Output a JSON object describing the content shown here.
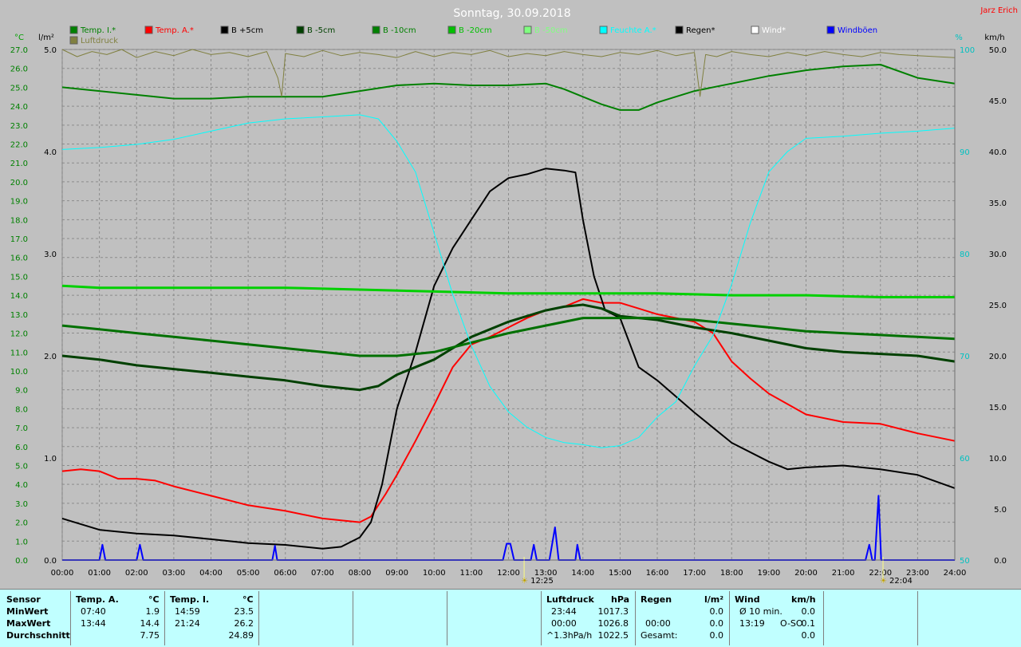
{
  "title": "Sonntag, 30.09.2018",
  "author": "Jarz Erich",
  "units": {
    "left_temp": "°C",
    "left_rain": "l/m²",
    "right_pct": "%",
    "right_kmh": "km/h"
  },
  "legend": [
    {
      "label": "Temp. I.*",
      "color": "#008000"
    },
    {
      "label": "Temp. A.*",
      "color": "#ff0000"
    },
    {
      "label": "B +5cm",
      "color": "#000000"
    },
    {
      "label": "B -5cm",
      "color": "#004000"
    },
    {
      "label": "B -10cm",
      "color": "#008000"
    },
    {
      "label": "B -20cm",
      "color": "#00c000"
    },
    {
      "label": "B -50cm",
      "color": "#80ff80"
    },
    {
      "label": "Feuchte A.*",
      "color": "#00ffff"
    },
    {
      "label": "Regen*",
      "color": "#000000"
    },
    {
      "label": "Wind*",
      "color": "#ffffff"
    },
    {
      "label": "Windböen",
      "color": "#0000ff"
    },
    {
      "label": "Luftdruck",
      "color": "#808040"
    }
  ],
  "chart_data": {
    "type": "line",
    "x_ticks": [
      "00:00",
      "01:00",
      "02:00",
      "03:00",
      "04:00",
      "05:00",
      "06:00",
      "07:00",
      "08:00",
      "09:00",
      "10:00",
      "11:00",
      "12:00",
      "13:00",
      "14:00",
      "15:00",
      "16:00",
      "17:00",
      "18:00",
      "19:00",
      "20:00",
      "21:00",
      "22:00",
      "23:00",
      "24:00"
    ],
    "xlim": [
      0,
      24
    ],
    "temp_axis": {
      "ylim": [
        0,
        27
      ],
      "ticks": [
        "0.0",
        "1.0",
        "2.0",
        "3.0",
        "4.0",
        "5.0",
        "6.0",
        "7.0",
        "8.0",
        "9.0",
        "10.0",
        "11.0",
        "12.0",
        "13.0",
        "14.0",
        "15.0",
        "16.0",
        "17.0",
        "18.0",
        "19.0",
        "20.0",
        "21.0",
        "22.0",
        "23.0",
        "24.0",
        "25.0",
        "26.0",
        "27.0"
      ]
    },
    "rain_axis": {
      "ylim": [
        0,
        5
      ],
      "ticks": [
        "0.0",
        "1.0",
        "2.0",
        "3.0",
        "4.0",
        "5.0"
      ]
    },
    "humidity_axis": {
      "ylim": [
        50,
        100
      ],
      "ticks": [
        "50",
        "60",
        "70",
        "80",
        "90",
        "100"
      ]
    },
    "wind_axis": {
      "ylim": [
        0,
        50
      ],
      "ticks": [
        "0.0",
        "5.0",
        "10.0",
        "15.0",
        "20.0",
        "25.0",
        "30.0",
        "35.0",
        "40.0",
        "45.0",
        "50.0"
      ]
    },
    "sun_events": [
      {
        "x": 12.42,
        "label": "12:25"
      },
      {
        "x": 22.07,
        "label": "22:04"
      }
    ],
    "series": [
      {
        "name": "Temp. I.*",
        "color": "#008000",
        "width": 2,
        "axis": "temp",
        "x": [
          0,
          1,
          2,
          3,
          4,
          5,
          6,
          7,
          8,
          9,
          10,
          11,
          12,
          13,
          13.5,
          14,
          14.5,
          15,
          15.5,
          16,
          17,
          18,
          19,
          20,
          21,
          22,
          23,
          24
        ],
        "y": [
          25.0,
          24.8,
          24.6,
          24.4,
          24.4,
          24.5,
          24.5,
          24.5,
          24.8,
          25.1,
          25.2,
          25.1,
          25.1,
          25.2,
          24.9,
          24.5,
          24.1,
          23.8,
          23.8,
          24.2,
          24.8,
          25.2,
          25.6,
          25.9,
          26.1,
          26.2,
          25.5,
          25.2
        ]
      },
      {
        "name": "Temp. A.*",
        "color": "#ff0000",
        "width": 2,
        "axis": "temp",
        "x": [
          0,
          0.5,
          1,
          1.5,
          2,
          2.5,
          3,
          4,
          5,
          6,
          7,
          7.5,
          8,
          8.3,
          8.7,
          9,
          9.5,
          10,
          10.5,
          11,
          11.5,
          12,
          12.5,
          13,
          13.5,
          14,
          14.5,
          15,
          15.5,
          16,
          16.5,
          17,
          17.5,
          18,
          18.5,
          19,
          20,
          21,
          22,
          23,
          24
        ],
        "y": [
          4.7,
          4.8,
          4.7,
          4.3,
          4.3,
          4.2,
          3.9,
          3.4,
          2.9,
          2.6,
          2.2,
          2.1,
          2.0,
          2.3,
          3.5,
          4.5,
          6.3,
          8.2,
          10.2,
          11.4,
          11.8,
          12.3,
          12.8,
          13.2,
          13.4,
          13.8,
          13.6,
          13.6,
          13.3,
          13.0,
          12.8,
          12.6,
          12.0,
          10.5,
          9.6,
          8.8,
          7.7,
          7.3,
          7.2,
          6.7,
          6.3
        ]
      },
      {
        "name": "B +5cm",
        "color": "#000000",
        "width": 2,
        "axis": "temp",
        "x": [
          0,
          1,
          2,
          3,
          4,
          5,
          6,
          7,
          7.5,
          8,
          8.3,
          8.6,
          9,
          9.5,
          10,
          10.5,
          11,
          11.5,
          12,
          12.5,
          13,
          13.5,
          13.8,
          14,
          14.3,
          14.6,
          15,
          15.5,
          16,
          17,
          18,
          19,
          19.5,
          20,
          21,
          22,
          23,
          24
        ],
        "y": [
          2.2,
          1.6,
          1.4,
          1.3,
          1.1,
          0.9,
          0.8,
          0.6,
          0.7,
          1.2,
          2.0,
          4.0,
          8.0,
          11.0,
          14.5,
          16.5,
          18.0,
          19.5,
          20.2,
          20.4,
          20.7,
          20.6,
          20.5,
          18.0,
          15.0,
          13.2,
          12.8,
          10.2,
          9.5,
          7.8,
          6.2,
          5.2,
          4.8,
          4.9,
          5.0,
          4.8,
          4.5,
          3.8
        ]
      },
      {
        "name": "B -5cm",
        "color": "#004000",
        "width": 3,
        "axis": "temp",
        "x": [
          0,
          1,
          2,
          3,
          4,
          5,
          6,
          7,
          8,
          8.5,
          9,
          9.5,
          10,
          10.5,
          11,
          12,
          13,
          13.5,
          14,
          14.5,
          15,
          16,
          17,
          18,
          19,
          20,
          21,
          22,
          23,
          24
        ],
        "y": [
          10.8,
          10.6,
          10.3,
          10.1,
          9.9,
          9.7,
          9.5,
          9.2,
          9.0,
          9.2,
          9.8,
          10.2,
          10.6,
          11.2,
          11.8,
          12.6,
          13.2,
          13.4,
          13.5,
          13.3,
          12.9,
          12.7,
          12.3,
          12.0,
          11.6,
          11.2,
          11.0,
          10.9,
          10.8,
          10.5
        ]
      },
      {
        "name": "B -10cm",
        "color": "#007000",
        "width": 3,
        "axis": "temp",
        "x": [
          0,
          1,
          2,
          3,
          4,
          5,
          6,
          7,
          8,
          9,
          10,
          11,
          12,
          13,
          14,
          15,
          16,
          17,
          18,
          19,
          20,
          21,
          22,
          23,
          24
        ],
        "y": [
          12.4,
          12.2,
          12.0,
          11.8,
          11.6,
          11.4,
          11.2,
          11.0,
          10.8,
          10.8,
          11.0,
          11.5,
          12.0,
          12.4,
          12.8,
          12.8,
          12.8,
          12.7,
          12.5,
          12.3,
          12.1,
          12.0,
          11.9,
          11.8,
          11.7
        ]
      },
      {
        "name": "B -20cm",
        "color": "#00d000",
        "width": 3,
        "axis": "temp",
        "x": [
          0,
          1,
          2,
          4,
          6,
          8,
          10,
          12,
          14,
          16,
          18,
          20,
          22,
          24
        ],
        "y": [
          14.5,
          14.4,
          14.4,
          14.4,
          14.4,
          14.3,
          14.2,
          14.1,
          14.1,
          14.1,
          14.0,
          14.0,
          13.9,
          13.9
        ]
      },
      {
        "name": "Feuchte A.*",
        "color": "#00ffff",
        "width": 1,
        "axis": "humidity",
        "x": [
          0,
          1,
          2,
          3,
          4,
          5,
          6,
          7,
          8,
          8.5,
          9,
          9.5,
          10,
          10.5,
          11,
          11.5,
          12,
          12.5,
          13,
          13.5,
          14,
          14.5,
          15,
          15.5,
          16,
          16.5,
          17,
          17.5,
          18,
          18.5,
          19,
          19.5,
          20,
          21,
          22,
          23,
          24
        ],
        "y": [
          90.2,
          90.4,
          90.7,
          91.2,
          92.0,
          92.8,
          93.2,
          93.4,
          93.6,
          93.2,
          91.0,
          88.0,
          82.0,
          76.0,
          71.0,
          67.0,
          64.5,
          63.0,
          62.0,
          61.5,
          61.3,
          61.0,
          61.2,
          62.0,
          64.0,
          65.5,
          69.0,
          72.0,
          77.0,
          83.0,
          88.0,
          90.0,
          91.3,
          91.5,
          91.8,
          92.0,
          92.3
        ]
      },
      {
        "name": "Luftdruck",
        "color": "#808040",
        "width": 1,
        "axis": "pressure",
        "x": [
          0,
          0.4,
          0.8,
          1.2,
          1.6,
          2,
          2.5,
          3,
          3.5,
          4,
          4.5,
          5,
          5.5,
          5.8,
          5.9,
          6,
          6.5,
          7,
          7.5,
          8,
          8.5,
          9,
          9.5,
          10,
          10.5,
          11,
          11.5,
          12,
          12.5,
          13,
          13.5,
          14,
          14.5,
          15,
          15.5,
          16,
          16.5,
          17,
          17.15,
          17.3,
          17.6,
          18,
          18.5,
          19,
          19.5,
          20,
          20.5,
          21,
          21.5,
          22,
          22.5,
          23,
          23.5,
          24
        ],
        "y": [
          5.0,
          4.93,
          4.98,
          4.95,
          5.0,
          4.92,
          4.98,
          4.94,
          5.0,
          4.95,
          4.97,
          4.93,
          4.98,
          4.72,
          4.54,
          4.96,
          4.93,
          4.99,
          4.94,
          4.97,
          4.95,
          4.92,
          4.98,
          4.93,
          4.97,
          4.95,
          4.99,
          4.93,
          4.96,
          4.94,
          4.98,
          4.95,
          4.93,
          4.97,
          4.95,
          4.99,
          4.94,
          4.97,
          4.54,
          4.95,
          4.93,
          4.98,
          4.95,
          4.93,
          4.97,
          4.94,
          4.98,
          4.95,
          4.93,
          4.97,
          4.95,
          4.94,
          4.93,
          4.92
        ]
      },
      {
        "name": "Windböen",
        "color": "#0000ff",
        "width": 2,
        "axis": "wind",
        "x": [
          0,
          1.0,
          1.08,
          1.16,
          1.2,
          2.0,
          2.09,
          2.18,
          2.2,
          5.65,
          5.72,
          5.78,
          5.8,
          11.85,
          11.95,
          12.05,
          12.15,
          12.25,
          12.6,
          12.68,
          12.76,
          12.8,
          13.1,
          13.25,
          13.35,
          13.8,
          13.85,
          13.93,
          14.0,
          21.6,
          21.7,
          21.78,
          21.8,
          21.85,
          21.95,
          22.02,
          22.06,
          24
        ],
        "y": [
          0,
          0,
          1.5,
          0,
          0,
          0,
          1.5,
          0,
          0,
          0,
          1.4,
          0,
          0,
          0,
          1.6,
          1.6,
          0,
          0,
          0,
          1.5,
          0,
          0,
          0,
          3.2,
          0,
          0,
          1.5,
          0,
          0,
          0,
          1.5,
          0,
          0,
          0,
          6.3,
          0,
          0,
          0
        ]
      }
    ]
  },
  "stats": {
    "sensor": {
      "label": "Sensor",
      "rows": [
        "MinWert",
        "MaxWert",
        "Durchschnitt"
      ]
    },
    "temp_a": {
      "label": "Temp. A.",
      "unit": "°C",
      "min_time": "07:40",
      "min_value": "1.9",
      "max_time": "13:44",
      "max_value": "14.4",
      "avg": "7.75"
    },
    "temp_i": {
      "label": "Temp. I.",
      "unit": "°C",
      "min_time": "14:59",
      "min_value": "23.5",
      "max_time": "21:24",
      "max_value": "26.2",
      "avg": "24.89"
    },
    "pressure": {
      "label": "Luftdruck",
      "unit": "hPa",
      "min_time": "23:44",
      "min_value": "1017.3",
      "max_time": "00:00",
      "max_value": "1026.8",
      "trend": "^1.3hPa/h",
      "trend_value": "1022.5"
    },
    "rain": {
      "label": "Regen",
      "unit": "l/m²",
      "min_value": "0.0",
      "max_time": "00:00",
      "max_value": "0.0",
      "total_label": "Gesamt:",
      "total": "0.0"
    },
    "wind": {
      "label": "Wind",
      "unit": "km/h",
      "avg_label": "Ø 10 min.",
      "avg_value": "0.0",
      "max_time": "13:19",
      "max_dir": "O-SO",
      "max_value": "0.1",
      "total_value": "0.0"
    }
  }
}
